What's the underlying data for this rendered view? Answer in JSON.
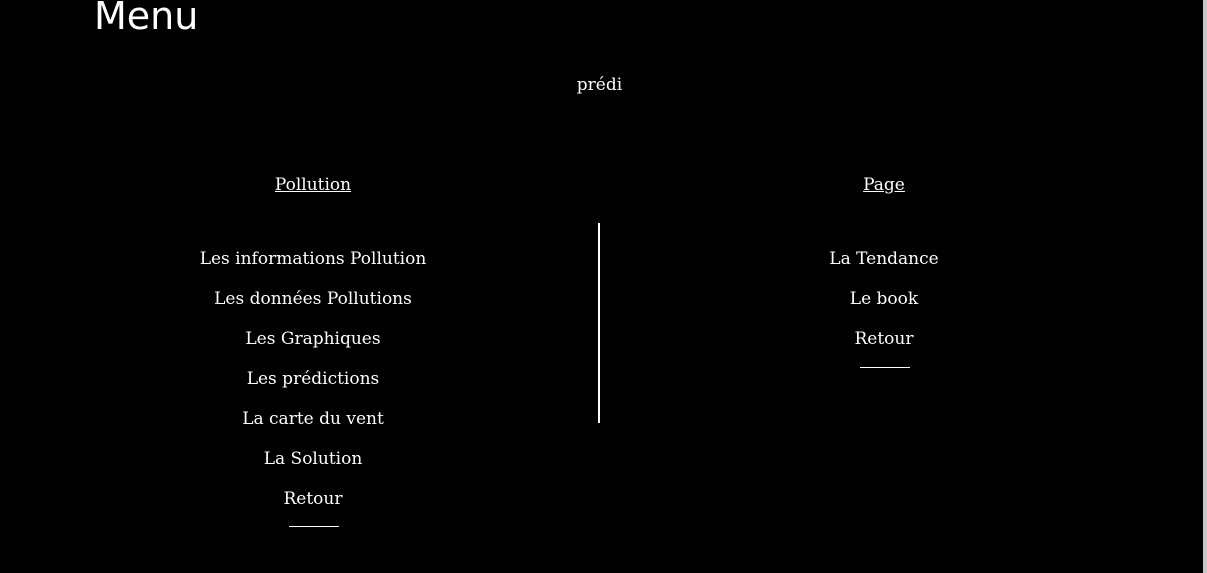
{
  "header": {
    "title": "Menu",
    "subtitle": "prédi"
  },
  "left_column": {
    "heading": "Pollution",
    "links": [
      "Les informations Pollution",
      "Les données Pollutions",
      "Les Graphiques",
      "Les prédictions",
      "La carte du vent",
      "La Solution",
      "Retour"
    ]
  },
  "right_column": {
    "heading": "Page",
    "links": [
      "La Tendance",
      "Le book",
      "Retour"
    ]
  },
  "colors": {
    "background": "#000000",
    "text": "#ffffff",
    "edge": "#c8c8c8"
  }
}
